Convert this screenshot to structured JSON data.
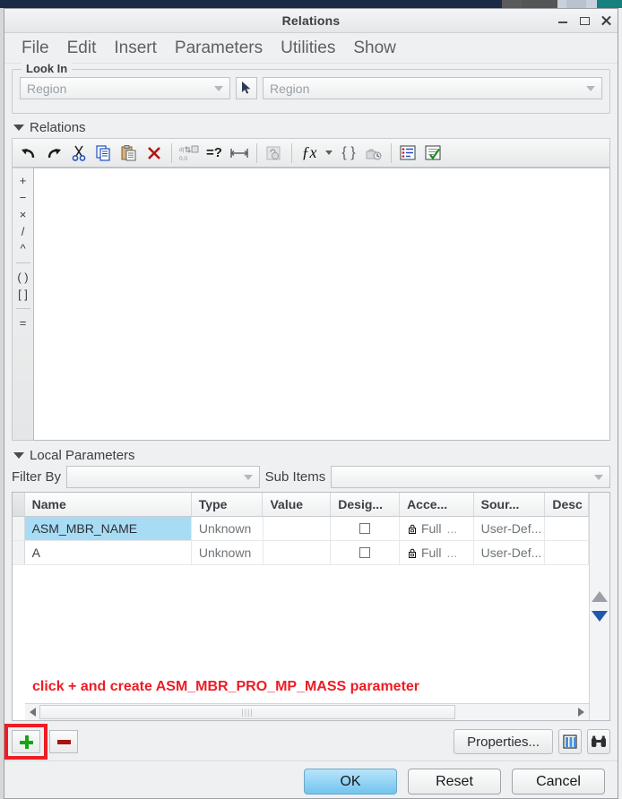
{
  "window": {
    "title": "Relations",
    "controls": [
      {
        "name": "minimize",
        "glyph": "minimize-icon"
      },
      {
        "name": "maximize",
        "glyph": "maximize-icon"
      },
      {
        "name": "close",
        "glyph": "close-icon"
      }
    ]
  },
  "menu": {
    "items": [
      {
        "label": "File"
      },
      {
        "label": "Edit"
      },
      {
        "label": "Insert"
      },
      {
        "label": "Parameters"
      },
      {
        "label": "Utilities"
      },
      {
        "label": "Show"
      }
    ]
  },
  "look_in": {
    "legend": "Look In",
    "type_combo": {
      "value": "Region",
      "placeholder": "Region"
    },
    "picker_icon": "cursor-arrow-icon",
    "target_combo": {
      "value": "Region",
      "placeholder": "Region"
    }
  },
  "relations": {
    "section_title": "Relations",
    "toolbar": [
      {
        "name": "undo-icon",
        "glyph": "↶"
      },
      {
        "name": "redo-icon",
        "glyph": "↷"
      },
      {
        "name": "cut-icon",
        "glyph": "✂"
      },
      {
        "name": "copy-icon",
        "glyph": "⧉"
      },
      {
        "name": "paste-icon",
        "glyph": "📋"
      },
      {
        "name": "delete-icon",
        "glyph": "✕"
      },
      {
        "name": "sort-icon",
        "glyph": "⇅"
      },
      {
        "name": "equals-question-icon",
        "glyph": "=?"
      },
      {
        "name": "measure-icon",
        "glyph": "↔"
      },
      {
        "name": "units-icon",
        "glyph": "⚖"
      },
      {
        "name": "function-icon",
        "glyph": "ƒx"
      },
      {
        "name": "function-dropdown-icon",
        "glyph": "▾"
      },
      {
        "name": "braces-icon",
        "glyph": "{ }"
      },
      {
        "name": "history-icon",
        "glyph": "⏱"
      },
      {
        "name": "list-icon",
        "glyph": "☰"
      },
      {
        "name": "verify-icon",
        "glyph": "✔"
      }
    ],
    "operators": [
      "+",
      "−",
      "×",
      "/",
      "^"
    ],
    "brackets": [
      "( )",
      "[ ]"
    ],
    "equals": "=",
    "editor_text": ""
  },
  "local_parameters": {
    "section_title": "Local Parameters",
    "filter_label": "Filter By",
    "filter_value": "",
    "sub_items_label": "Sub Items",
    "sub_items_value": "",
    "columns": [
      "Name",
      "Type",
      "Value",
      "Desig...",
      "Acce...",
      "Sour...",
      "Desc"
    ],
    "rows": [
      {
        "name": "ASM_MBR_NAME",
        "type": "Unknown",
        "value": "",
        "designate": false,
        "access": "Full",
        "access_more": "...",
        "source": "User-Def...",
        "description": "",
        "selected": true
      },
      {
        "name": "A",
        "type": "Unknown",
        "value": "",
        "designate": false,
        "access": "Full",
        "access_more": "...",
        "source": "User-Def...",
        "description": "",
        "selected": false
      }
    ],
    "annotation": "click + and create ASM_MBR_PRO_MP_MASS parameter",
    "scroll_up_icon": "scroll-up-arrow-icon",
    "scroll_down_icon": "scroll-down-arrow-icon"
  },
  "actions": {
    "add_icon": "plus-icon",
    "remove_icon": "minus-icon",
    "properties_label": "Properties...",
    "columns_icon": "columns-icon",
    "find_icon": "binoculars-icon",
    "highlight_color": "#ee1c25"
  },
  "dialog_buttons": {
    "ok": "OK",
    "reset": "Reset",
    "cancel": "Cancel"
  },
  "colors": {
    "selection": "#a8dcf5",
    "annotation": "#ee1c25",
    "primary_button": "#72c4ef"
  }
}
